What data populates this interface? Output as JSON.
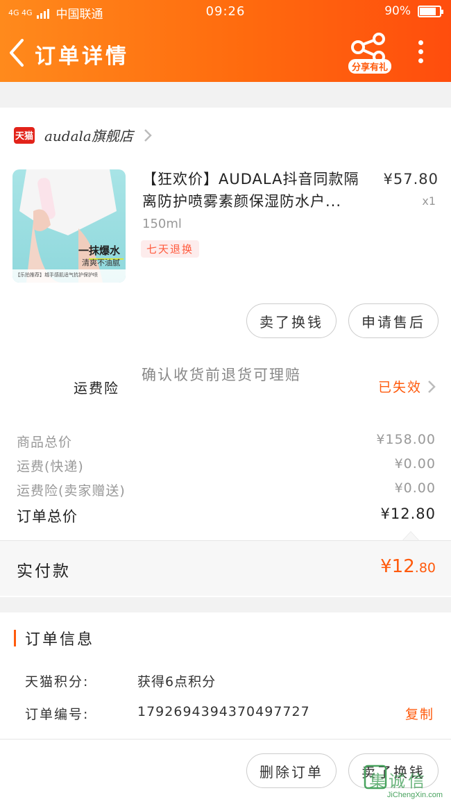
{
  "status_bar": {
    "network": "4G 4G",
    "carrier": "中国联通",
    "time": "09:26",
    "battery": "90%",
    "battery_level": 0.9
  },
  "nav": {
    "title": "订单详情",
    "share_badge": "分享有礼"
  },
  "store": {
    "badge": "天猫",
    "name": "audala旗舰店"
  },
  "product": {
    "image_headline": "一抹爆水",
    "image_sub": "清爽不油腻",
    "image_strip": "【乐拍推荐】城手感肌适气抗护保护喷",
    "title": "【狂欢价】AUDALA抖音同款隔离防护喷雾素颜保湿防水户...",
    "spec": "150ml",
    "tag": "七天退换",
    "price": "¥57.80",
    "qty": "x1"
  },
  "actions": {
    "refund": "卖了换钱",
    "after_sale": "申请售后"
  },
  "insurance": {
    "label": "运费险",
    "desc": "确认收货前退货可理赔",
    "status": "已失效"
  },
  "summary": [
    {
      "label": "商品总价",
      "value": "¥158.00"
    },
    {
      "label": "运费(快递)",
      "value": "¥0.00"
    },
    {
      "label": "运费险(卖家赠送)",
      "value": "¥0.00"
    },
    {
      "label": "订单总价",
      "value": "¥12.80"
    }
  ],
  "payment": {
    "label": "实付款",
    "amount_int": "¥12",
    "amount_dec": ".80"
  },
  "order_info": {
    "title": "订单信息",
    "rows": [
      {
        "key": "天猫积分:",
        "value": "获得6点积分"
      },
      {
        "key": "订单编号:",
        "value": "1792694394370497727",
        "action": "复制"
      }
    ]
  },
  "bottom": {
    "delete": "删除订单",
    "sell": "卖了换钱"
  },
  "watermark": {
    "text": "JiChengXin.com",
    "glyphs": "集诚信"
  },
  "colors": {
    "accent": "#ff5a0c",
    "header_start": "#ff8a1c",
    "header_end": "#ff4d0d"
  }
}
